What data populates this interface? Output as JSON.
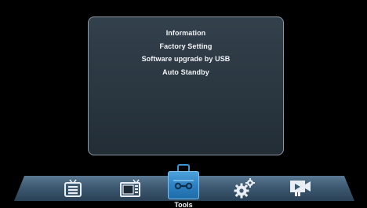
{
  "tools_menu": {
    "items": [
      "Information",
      "Factory Setting",
      "Software upgrade by USB",
      "Auto Standby"
    ]
  },
  "bottom_nav": {
    "selected_label": "Tools",
    "icons": [
      "tv-list-icon",
      "tv-screen-icon",
      "toolbox-icon",
      "gears-icon",
      "media-player-icon"
    ],
    "accent_color": "#2a7fc0"
  }
}
